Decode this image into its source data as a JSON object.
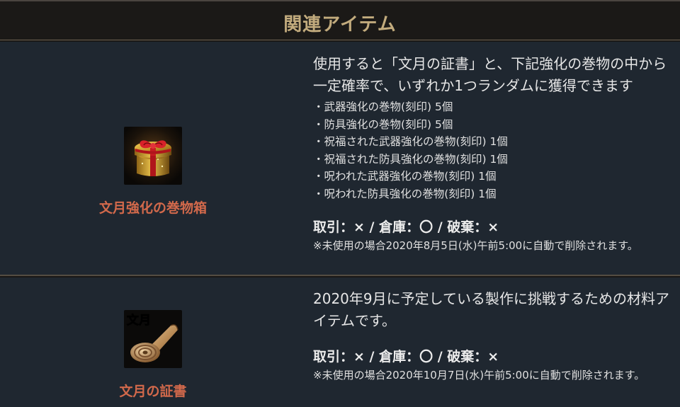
{
  "header": {
    "title": "関連アイテム"
  },
  "items": [
    {
      "name": "文月強化の巻物箱",
      "icon": "gift-box-icon",
      "description": "使用すると「文月の証書」と、下記強化の巻物の中から一定確率で、いずれか1つランダムに獲得できます",
      "rewards": [
        "・武器強化の巻物(刻印) 5個",
        "・防具強化の巻物(刻印) 5個",
        "・祝福された武器強化の巻物(刻印) 1個",
        "・祝福された防具強化の巻物(刻印) 1個",
        "・呪われた武器強化の巻物(刻印) 1個",
        "・呪われた防具強化の巻物(刻印) 1個"
      ],
      "trade": "取引：× / 倉庫：〇 / 破棄：×",
      "note": "※未使用の場合2020年8月5日(水)午前5:00に自動で削除されます。"
    },
    {
      "name": "文月の証書",
      "icon": "scroll-icon",
      "icon_label": "文月",
      "description": "2020年9月に予定している製作に挑戦するための材料アイテムです。",
      "trade": "取引：× / 倉庫：〇 / 破棄：×",
      "note": "※未使用の場合2020年10月7日(水)午前5:00に自動で削除されます。"
    }
  ],
  "colors": {
    "header_bg": "#1b1917",
    "header_text": "#c2ab7d",
    "row_bg": "#1f2730",
    "item_name": "#d2694b",
    "text": "#e6e6e6"
  }
}
